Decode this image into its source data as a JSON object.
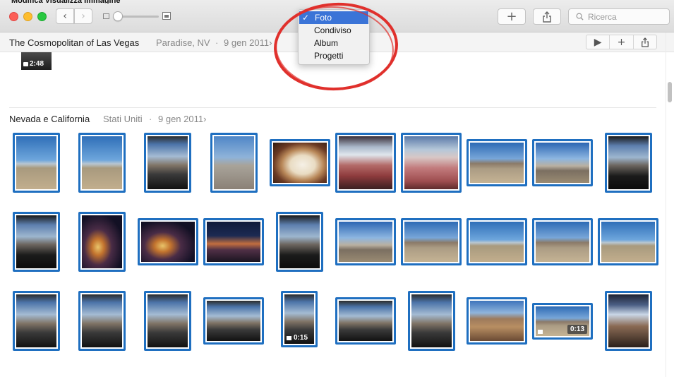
{
  "window": {
    "menubar_fragment": "Modifica  Visualizza  Immagine"
  },
  "toolbar": {
    "back_glyph": "‹",
    "forward_glyph": "›",
    "add_glyph": "+",
    "share_icon": "share-icon",
    "search_placeholder": "Ricerca"
  },
  "view_menu": {
    "items": [
      {
        "label": "Foto",
        "selected": true,
        "check": "✓"
      },
      {
        "label": "Condiviso",
        "selected": false
      },
      {
        "label": "Album",
        "selected": false
      },
      {
        "label": "Progetti",
        "selected": false
      }
    ],
    "highlight_color": "#3b74d7",
    "annotation_color": "#e0302c"
  },
  "moments": [
    {
      "title": "The Cosmopolitan of Las Vegas",
      "location": "Paradise, NV",
      "separator": "·",
      "date": "9 gen 2011",
      "chevron": "›",
      "actions": [
        "▶",
        "+",
        "share-icon"
      ],
      "video_duration": "2:48"
    },
    {
      "title": "Nevada e California",
      "location": "Stati Uniti",
      "separator": "·",
      "date": "9 gen 2011",
      "chevron": "›",
      "durations": {
        "row3_col5": "0:15",
        "row3_col9": "0:13"
      }
    }
  ],
  "colors": {
    "selection_border": "#1f6fc0",
    "accent": "#3b74d7"
  }
}
